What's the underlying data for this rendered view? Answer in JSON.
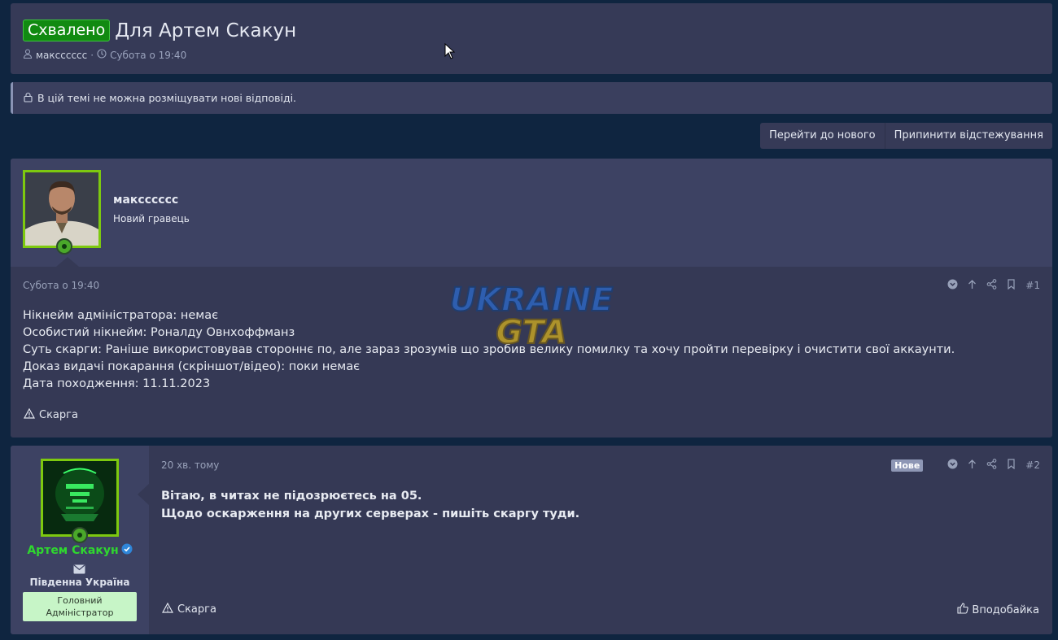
{
  "thread": {
    "status_badge": "Схвалено",
    "title": "Для Артем Скакун",
    "author": "максссссс",
    "separator": "·",
    "date": "Субота о 19:40"
  },
  "notice": {
    "text": "В цій темі не можна розміщувати нові відповіді."
  },
  "toolbar": {
    "goto_new": "Перейти до нового",
    "unwatch": "Припинити відстежування"
  },
  "watermark": {
    "line1": "UKRAINE",
    "line2": "GTA"
  },
  "posts": [
    {
      "username": "максссссс",
      "user_title": "Новий гравець",
      "date": "Субота о 19:40",
      "number": "#1",
      "lines": [
        "Нікнейм адміністратора: немає",
        "Особистий нікнейм: Роналду Овнхоффманз",
        "Суть скарги: Раніше використовував стороннє по, але зараз зрозумів що зробив велику помилку та хочу пройти перевірку і очистити свої аккаунти.",
        "Доказ видачі покарання (скріншот/відео): поки немає",
        "Дата походження: 11.11.2023"
      ],
      "report_label": "Скарга"
    },
    {
      "username": "Артем Скакун",
      "location": "Південна Україна",
      "rank_line1": "Головний",
      "rank_line2": "Адміністратор",
      "date": "20 хв. тому",
      "new_badge": "Нове",
      "number": "#2",
      "lines": [
        "Вітаю, в читах не підозрюєтесь на 05.",
        "Щодо оскарження на других серверах - пишіть скаргу туди."
      ],
      "report_label": "Скарга",
      "like_label": "Вподобайка"
    }
  ],
  "colors": {
    "background": "#0f2540",
    "block": "#363a57",
    "approved": "#118a11",
    "avatar_border": "#7dc90f",
    "admin_name": "#2fd82f",
    "rank_bg": "#c7f5c7"
  }
}
